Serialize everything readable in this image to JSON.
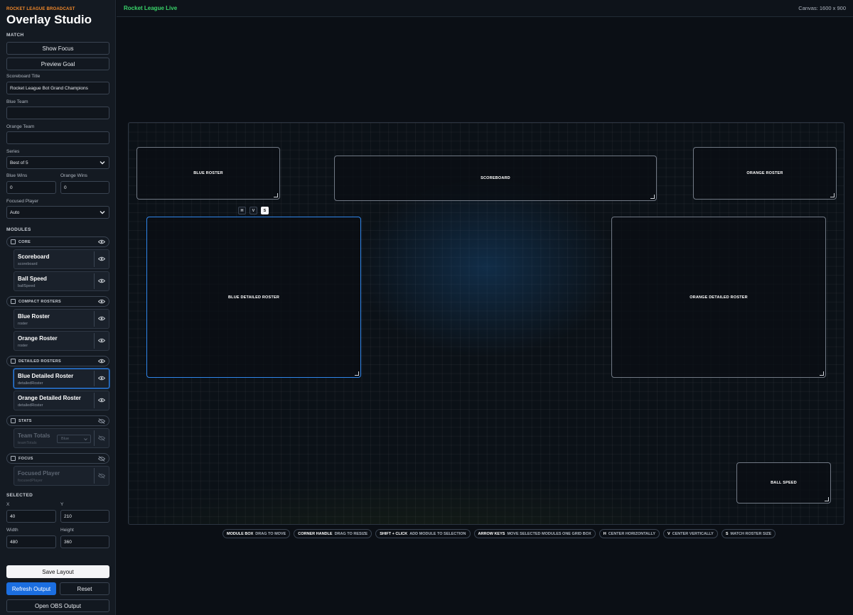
{
  "sidebar": {
    "kicker": "ROCKET LEAGUE BROADCAST",
    "title": "Overlay Studio",
    "match": {
      "heading": "MATCH",
      "show_focus": "Show Focus",
      "preview_goal": "Preview Goal",
      "scoreboard_title_label": "Scoreboard Title",
      "scoreboard_title_value": "Rocket League Bot Grand Champions",
      "blue_team_label": "Blue Team",
      "blue_team_value": "",
      "orange_team_label": "Orange Team",
      "orange_team_value": "",
      "series_label": "Series",
      "series_value": "Best of 5",
      "blue_wins_label": "Blue Wins",
      "blue_wins_value": "0",
      "orange_wins_label": "Orange Wins",
      "orange_wins_value": "0",
      "focused_player_label": "Focused Player",
      "focused_player_value": "Auto"
    },
    "modules": {
      "heading": "MODULES",
      "groups": [
        {
          "label": "CORE",
          "items": [
            {
              "name": "Scoreboard",
              "key": "scoreboard"
            },
            {
              "name": "Ball Speed",
              "key": "ballSpeed"
            }
          ]
        },
        {
          "label": "COMPACT ROSTERS",
          "items": [
            {
              "name": "Blue Roster",
              "key": "roster"
            },
            {
              "name": "Orange Roster",
              "key": "roster"
            }
          ]
        },
        {
          "label": "DETAILED ROSTERS",
          "items": [
            {
              "name": "Blue Detailed Roster",
              "key": "detailedRoster"
            },
            {
              "name": "Orange Detailed Roster",
              "key": "detailedRoster"
            }
          ]
        },
        {
          "label": "STATS",
          "items": [
            {
              "name": "Team Totals",
              "key": "teamTotals",
              "select": "Blue"
            }
          ]
        },
        {
          "label": "FOCUS",
          "items": [
            {
              "name": "Focused Player",
              "key": "focusedPlayer"
            }
          ]
        }
      ]
    },
    "selected": {
      "heading": "SELECTED",
      "x_label": "X",
      "x_value": "40",
      "y_label": "Y",
      "y_value": "210",
      "w_label": "Width",
      "w_value": "480",
      "h_label": "Height",
      "h_value": "360"
    },
    "actions": {
      "save": "Save Layout",
      "refresh": "Refresh Output",
      "reset": "Reset",
      "open_obs": "Open OBS Output"
    }
  },
  "topbar": {
    "title": "Rocket League Live",
    "canvas_size": "Canvas: 1600 x 900"
  },
  "stage": {
    "boxes": {
      "blue_roster": "BLUE ROSTER",
      "scoreboard": "SCOREBOARD",
      "orange_roster": "ORANGE ROSTER",
      "blue_detailed": "BLUE DETAILED ROSTER",
      "orange_detailed": "ORANGE DETAILED ROSTER",
      "ball_speed": "BALL SPEED"
    },
    "tools": [
      "H",
      "V",
      "S"
    ]
  },
  "hints": [
    {
      "key": "MODULE BOX",
      "text": "DRAG TO MOVE"
    },
    {
      "key": "CORNER HANDLE",
      "text": "DRAG TO RESIZE"
    },
    {
      "key": "SHIFT + CLICK",
      "text": "ADD MODULE TO SELECTION"
    },
    {
      "key": "ARROW KEYS",
      "text": "MOVE SELECTED MODULES ONE GRID BOX"
    },
    {
      "key": "H",
      "text": "CENTER HORIZONTALLY"
    },
    {
      "key": "V",
      "text": "CENTER VERTICALLY"
    },
    {
      "key": "S",
      "text": "MATCH ROSTER SIZE"
    }
  ],
  "colors": {
    "accent_blue": "#1b6ee0",
    "live_green": "#39d46a",
    "kicker_orange": "#f58a2a"
  }
}
